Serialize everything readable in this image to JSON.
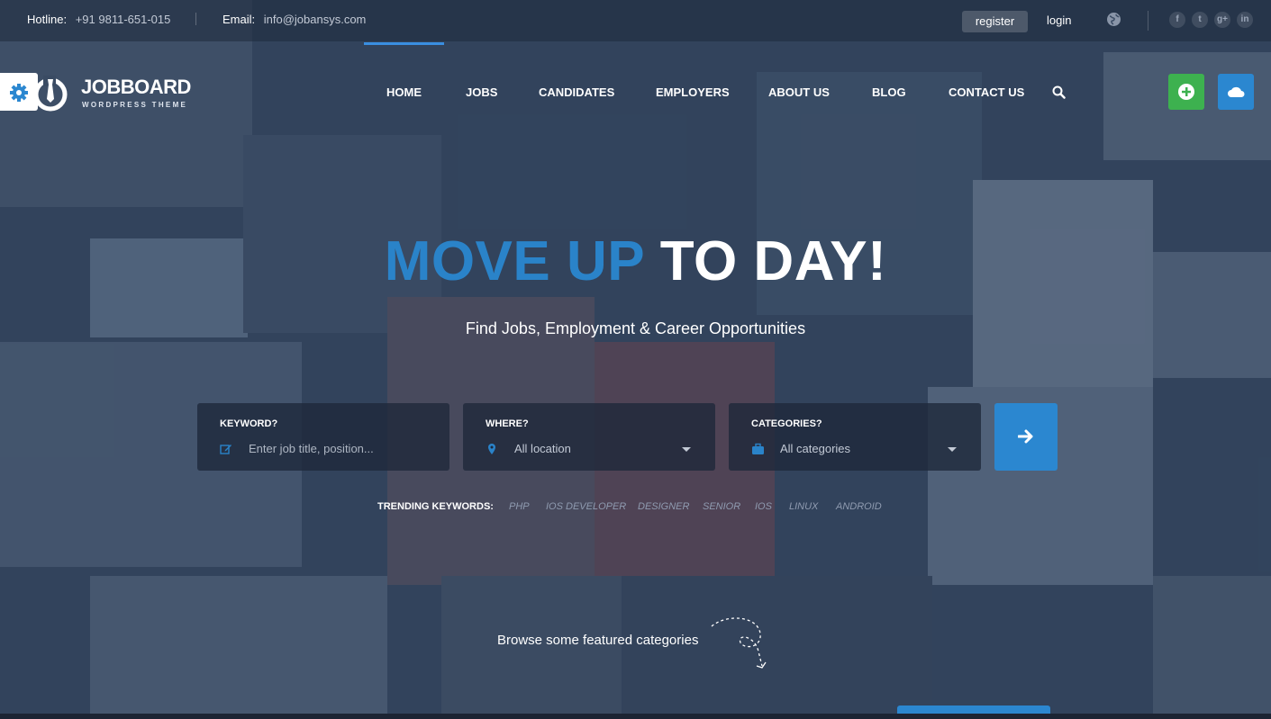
{
  "topbar": {
    "hotline_label": "Hotline:",
    "hotline_value": "+91 9811-651-015",
    "email_label": "Email:",
    "email_value": "info@jobansys.com",
    "register_label": "register",
    "login_label": "login",
    "social": [
      "f",
      "t",
      "g+",
      "in"
    ]
  },
  "logo": {
    "title": "JOBBOARD",
    "subtitle": "WORDPRESS THEME"
  },
  "nav": {
    "items": [
      "HOME",
      "JOBS",
      "CANDIDATES",
      "EMPLOYERS",
      "ABOUT US",
      "BLOG",
      "CONTACT US"
    ],
    "active": "HOME"
  },
  "hero": {
    "title_highlight": "MOVE UP",
    "title_rest": " TO DAY!",
    "subtitle": "Find Jobs, Employment & Career Opportunities"
  },
  "search": {
    "keyword": {
      "label": "KEYWORD?",
      "placeholder": "Enter job title, position..."
    },
    "where": {
      "label": "WHERE?",
      "value": "All location"
    },
    "categories": {
      "label": "CATEGORIES?",
      "value": "All categories"
    }
  },
  "trending": {
    "label": "TRENDING KEYWORDS:",
    "keywords": [
      "PHP",
      "IOS DEVELOPER",
      "DESIGNER",
      "SENIOR",
      "IOS",
      "LINUX",
      "ANDROID"
    ]
  },
  "browse": {
    "text": "Browse some featured categories"
  },
  "colors": {
    "accent_blue": "#2a83c9",
    "green": "#3db14f",
    "overlay": "#2c3e58"
  }
}
